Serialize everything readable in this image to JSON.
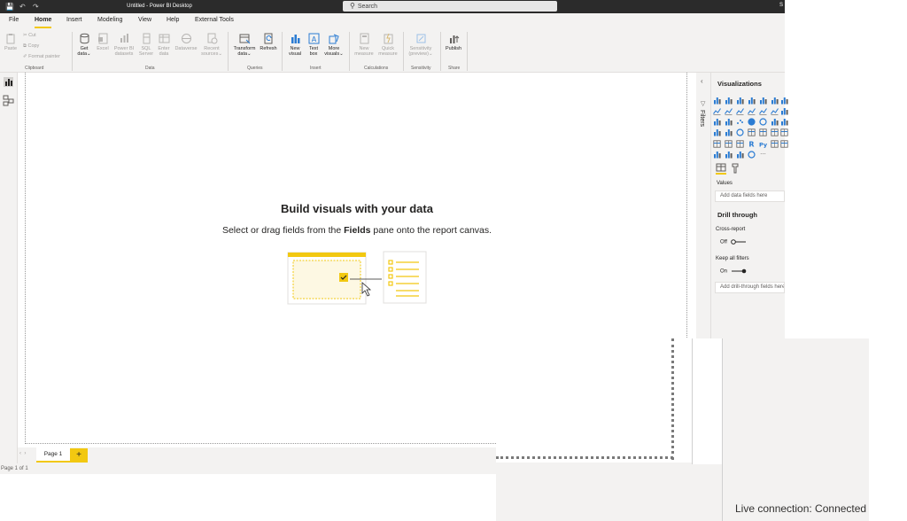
{
  "titlebar": {
    "title": "Untitled - Power BI Desktop",
    "search_placeholder": "Search",
    "user_initial": "S"
  },
  "menu": {
    "tabs": [
      "File",
      "Home",
      "Insert",
      "Modeling",
      "View",
      "Help",
      "External Tools"
    ],
    "active": "Home"
  },
  "ribbon": {
    "clipboard": {
      "paste": "Paste",
      "cut": "Cut",
      "copy": "Copy",
      "format_painter": "Format painter",
      "group": "Clipboard"
    },
    "data": {
      "get_data": [
        "Get",
        "data"
      ],
      "excel": "Excel",
      "pbi_datasets": [
        "Power BI",
        "datasets"
      ],
      "sql": [
        "SQL",
        "Server"
      ],
      "enter_data": [
        "Enter",
        "data"
      ],
      "dataverse": "Dataverse",
      "recent": [
        "Recent",
        "sources"
      ],
      "group": "Data"
    },
    "queries": {
      "transform": [
        "Transform",
        "data"
      ],
      "refresh": "Refresh",
      "group": "Queries"
    },
    "insert": {
      "new_visual": [
        "New",
        "visual"
      ],
      "text_box": [
        "Text",
        "box"
      ],
      "more_visuals": [
        "More",
        "visuals"
      ],
      "group": "Insert"
    },
    "calculations": {
      "new_measure": [
        "New",
        "measure"
      ],
      "quick_measure": [
        "Quick",
        "measure"
      ],
      "group": "Calculations"
    },
    "sensitivity": {
      "label": [
        "Sensitivity",
        "(preview)"
      ],
      "group": "Sensitivity"
    },
    "share": {
      "publish": "Publish",
      "group": "Share"
    }
  },
  "canvas": {
    "title": "Build visuals with your data",
    "subtitle_pre": "Select or drag fields from the ",
    "subtitle_bold": "Fields",
    "subtitle_post": " pane onto the report canvas."
  },
  "pages": {
    "tab": "Page 1",
    "add": "+",
    "status": "Page 1 of 1"
  },
  "filters": {
    "label": "Filters"
  },
  "visualizations": {
    "title": "Visualizations",
    "values_label": "Values",
    "values_placeholder": "Add data fields here",
    "drill_title": "Drill through",
    "cross_report": "Cross-report",
    "cross_report_state": "Off",
    "keep_filters": "Keep all filters",
    "keep_filters_state": "On",
    "drill_placeholder": "Add drill-through fields here",
    "r_icon": "R",
    "py_icon": "Py",
    "more": "···"
  },
  "status": {
    "live_connection": "Live connection: Connected"
  },
  "colors": {
    "accent": "#f2c811",
    "icon_blue": "#2b7cd3",
    "chrome": "#f3f2f1",
    "titlebar": "#2b2b2b"
  }
}
